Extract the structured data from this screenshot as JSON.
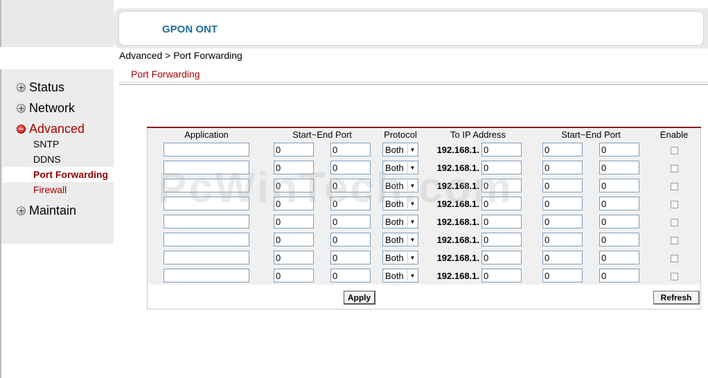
{
  "header": {
    "product": "GPON ONT"
  },
  "breadcrumb": "Advanced > Port Forwarding",
  "section_title": "Port Forwarding",
  "sidebar": {
    "status": "Status",
    "network": "Network",
    "advanced": "Advanced",
    "advanced_items": [
      "SNTP",
      "DDNS",
      "Port Forwarding",
      "Firewall"
    ],
    "maintain": "Maintain"
  },
  "table": {
    "headers": {
      "application": "Application",
      "start_end_port": "Start~End Port",
      "protocol": "Protocol",
      "to_ip": "To IP Address",
      "start_end_port2": "Start~End Port",
      "enable": "Enable"
    },
    "rows": [
      {
        "application": "",
        "start": "0",
        "end": "0",
        "protocol": "Both",
        "ip_prefix": "192.168.1.",
        "ip_last": "0",
        "to_start": "0",
        "to_end": "0",
        "enabled": false
      },
      {
        "application": "",
        "start": "0",
        "end": "0",
        "protocol": "Both",
        "ip_prefix": "192.168.1.",
        "ip_last": "0",
        "to_start": "0",
        "to_end": "0",
        "enabled": false
      },
      {
        "application": "",
        "start": "0",
        "end": "0",
        "protocol": "Both",
        "ip_prefix": "192.168.1.",
        "ip_last": "0",
        "to_start": "0",
        "to_end": "0",
        "enabled": false
      },
      {
        "application": "",
        "start": "0",
        "end": "0",
        "protocol": "Both",
        "ip_prefix": "192.168.1.",
        "ip_last": "0",
        "to_start": "0",
        "to_end": "0",
        "enabled": false
      },
      {
        "application": "",
        "start": "0",
        "end": "0",
        "protocol": "Both",
        "ip_prefix": "192.168.1.",
        "ip_last": "0",
        "to_start": "0",
        "to_end": "0",
        "enabled": false
      },
      {
        "application": "",
        "start": "0",
        "end": "0",
        "protocol": "Both",
        "ip_prefix": "192.168.1.",
        "ip_last": "0",
        "to_start": "0",
        "to_end": "0",
        "enabled": false
      },
      {
        "application": "",
        "start": "0",
        "end": "0",
        "protocol": "Both",
        "ip_prefix": "192.168.1.",
        "ip_last": "0",
        "to_start": "0",
        "to_end": "0",
        "enabled": false
      },
      {
        "application": "",
        "start": "0",
        "end": "0",
        "protocol": "Both",
        "ip_prefix": "192.168.1.",
        "ip_last": "0",
        "to_start": "0",
        "to_end": "0",
        "enabled": false
      }
    ]
  },
  "buttons": {
    "apply": "Apply",
    "refresh": "Refresh"
  },
  "watermark": "PcWinTech.com",
  "colors": {
    "accent_red": "#a40000",
    "brand_blue": "#1d6f9a",
    "table_rule": "#8b1d1d"
  }
}
